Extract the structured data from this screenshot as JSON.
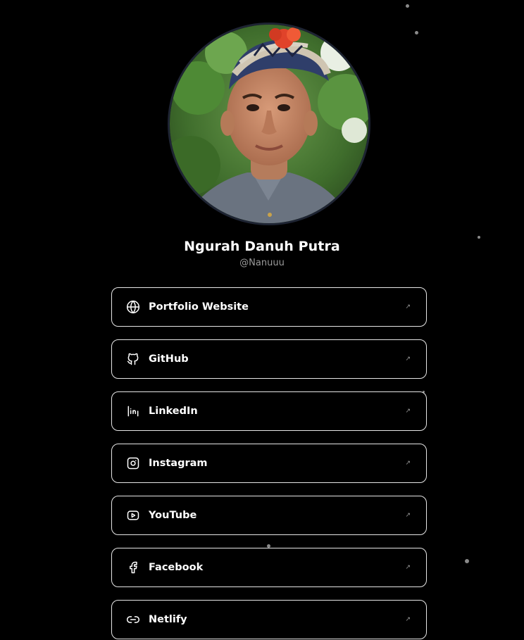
{
  "profile": {
    "name": "Ngurah Danuh Putra",
    "handle": "@Nanuuu"
  },
  "links": [
    {
      "label": "Portfolio Website",
      "icon": "globe-icon"
    },
    {
      "label": "GitHub",
      "icon": "github-icon"
    },
    {
      "label": "LinkedIn",
      "icon": "linkedin-icon"
    },
    {
      "label": "Instagram",
      "icon": "instagram-icon"
    },
    {
      "label": "YouTube",
      "icon": "youtube-icon"
    },
    {
      "label": "Facebook",
      "icon": "facebook-icon"
    },
    {
      "label": "Netlify",
      "icon": "link-icon"
    }
  ],
  "colors": {
    "background": "#000000",
    "text": "#ffffff",
    "muted": "#9a9a9a",
    "border": "#e6e6e6",
    "avatar_ring": "#1e2433"
  }
}
